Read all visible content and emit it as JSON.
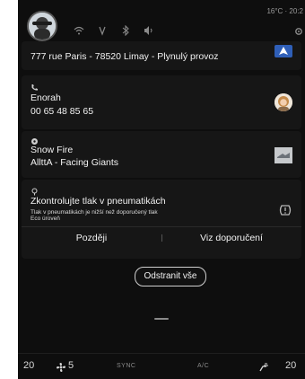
{
  "status": {
    "temperature": "16°C · 20:2"
  },
  "notifications": {
    "navigation": {
      "title": "777 rue Paris - 78520 Limay - Plynulý provoz"
    },
    "call": {
      "name": "Enorah",
      "number": "00 65 48 85 65"
    },
    "music": {
      "track": "Snow Fire",
      "artist": "AllttA - Facing Giants"
    },
    "tire": {
      "title": "Zkontrolujte tlak v pneumatikách",
      "detail_line1": "Tlak v pneumatikách je nižší než doporučený tlak",
      "detail_line2": "Eco úroveň",
      "later_label": "Později",
      "view_label": "Viz doporučení"
    }
  },
  "clear_all_label": "Odstranit vše",
  "climate": {
    "left_temp": "20",
    "fan_speed": "5",
    "sync_label": "SYNC",
    "ac_label": "A/C",
    "right_temp": "20"
  },
  "colors": {
    "background": "#0e0e0e",
    "card": "#161616",
    "accent_nav": "#2f5fb8"
  }
}
